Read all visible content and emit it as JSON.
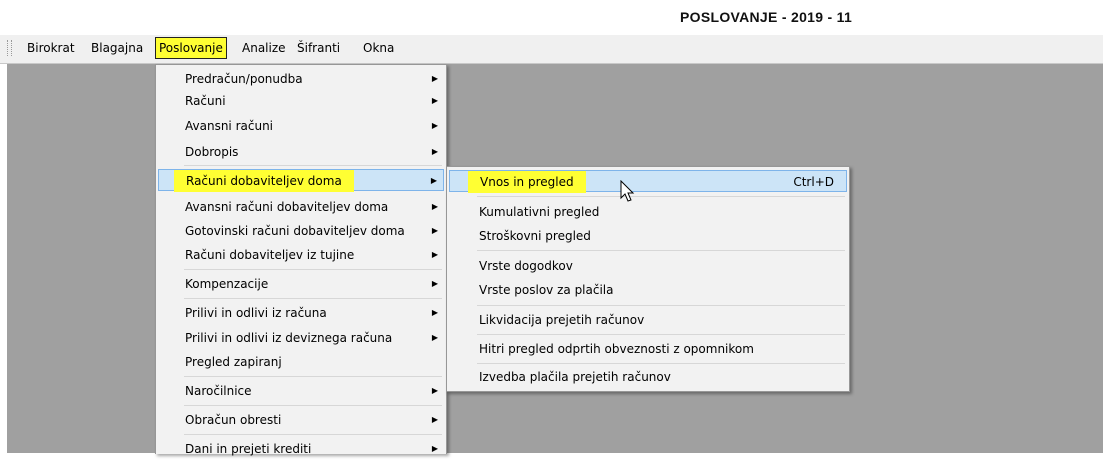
{
  "window": {
    "title": "POSLOVANJE - 2019 - 11"
  },
  "menubar": {
    "items": [
      {
        "label": "Birokrat",
        "selected": false
      },
      {
        "label": "Blagajna",
        "selected": false
      },
      {
        "label": "Poslovanje",
        "selected": true
      },
      {
        "label": "Analize",
        "selected": false
      },
      {
        "label": "Šifranti",
        "selected": false
      },
      {
        "label": "Okna",
        "selected": false
      }
    ]
  },
  "submenu": {
    "items": [
      {
        "label": "Predračun/ponudba",
        "arrow": "▶"
      },
      {
        "label": "Računi",
        "arrow": "▶"
      },
      {
        "label": "Avansni računi",
        "arrow": "▶"
      },
      {
        "label": "Dobropis",
        "arrow": "▶"
      },
      {
        "label": "Računi dobaviteljev doma",
        "arrow": "▶",
        "highlighted": true
      },
      {
        "label": "Avansni računi dobaviteljev doma",
        "arrow": "▶"
      },
      {
        "label": "Gotovinski računi dobaviteljev doma",
        "arrow": "▶"
      },
      {
        "label": "Računi dobaviteljev iz tujine",
        "arrow": "▶"
      },
      {
        "label": "Kompenzacije",
        "arrow": "▶"
      },
      {
        "label": "Prilivi in odlivi iz računa",
        "arrow": "▶"
      },
      {
        "label": "Prilivi in odlivi iz deviznega računa",
        "arrow": "▶"
      },
      {
        "label": "Pregled zapiranj",
        "arrow": ""
      },
      {
        "label": "Naročilnice",
        "arrow": "▶"
      },
      {
        "label": "Obračun obresti",
        "arrow": "▶"
      },
      {
        "label": "Dani in prejeti krediti",
        "arrow": "▶"
      }
    ]
  },
  "flyout": {
    "items": [
      {
        "label": "Vnos in pregled",
        "shortcut": "Ctrl+D",
        "highlighted": true
      },
      {
        "label": "Kumulativni pregled"
      },
      {
        "label": "Stroškovni pregled"
      },
      {
        "label": "Vrste dogodkov"
      },
      {
        "label": "Vrste poslov za plačila"
      },
      {
        "label": "Likvidacija prejetih računov"
      },
      {
        "label": "Hitri pregled odprtih obveznosti z opomnikom"
      },
      {
        "label": "Izvedba plačila prejetih računov"
      }
    ]
  },
  "colors": {
    "highlight": "#ffff33",
    "hover": "#cce4f7",
    "workspace": "#a0a0a0"
  },
  "icons": {
    "cursor": "mouse-pointer-icon",
    "submenu": "triangle-right-icon"
  }
}
